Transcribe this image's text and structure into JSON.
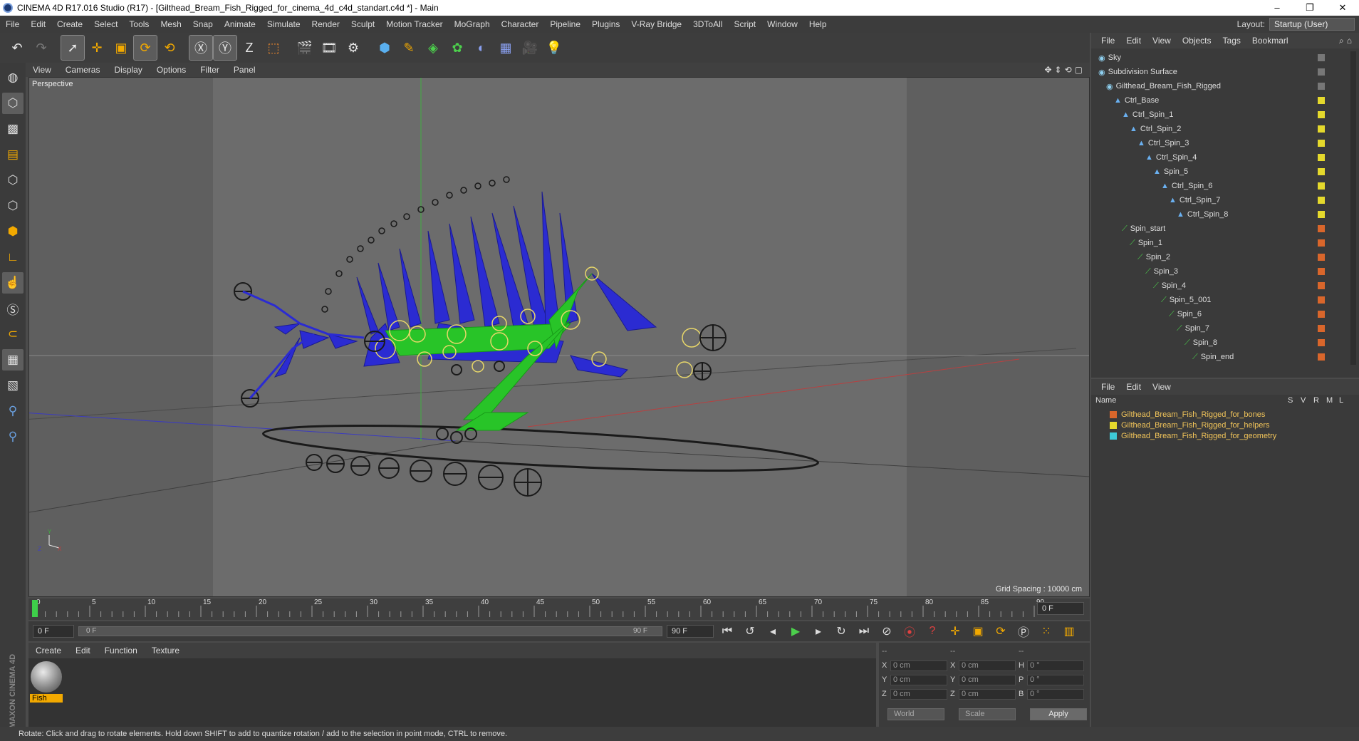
{
  "window": {
    "title": "CINEMA 4D R17.016 Studio (R17) - [Gilthead_Bream_Fish_Rigged_for_cinema_4d_c4d_standart.c4d *] - Main"
  },
  "menubar": {
    "items": [
      "File",
      "Edit",
      "Create",
      "Select",
      "Tools",
      "Mesh",
      "Snap",
      "Animate",
      "Simulate",
      "Render",
      "Sculpt",
      "Motion Tracker",
      "MoGraph",
      "Character",
      "Pipeline",
      "Plugins",
      "V-Ray Bridge",
      "3DToAll",
      "Script",
      "Window",
      "Help"
    ],
    "layout_label": "Layout:",
    "layout_value": "Startup (User)"
  },
  "viewport": {
    "menu": [
      "View",
      "Cameras",
      "Display",
      "Options",
      "Filter",
      "Panel"
    ],
    "label": "Perspective",
    "grid_spacing": "Grid Spacing : 10000 cm"
  },
  "timeline": {
    "ticks": [
      "0",
      "5",
      "10",
      "15",
      "20",
      "25",
      "30",
      "35",
      "40",
      "45",
      "50",
      "55",
      "60",
      "65",
      "70",
      "75",
      "80",
      "85",
      "90"
    ],
    "current_frame": "0 F",
    "start_frame": "0 F",
    "range_start": "0 F",
    "range_end": "90 F",
    "end_frame": "90 F"
  },
  "material": {
    "menu": [
      "Create",
      "Edit",
      "Function",
      "Texture"
    ],
    "name": "Fish"
  },
  "coords": {
    "header": [
      "--",
      "--",
      "--"
    ],
    "rows": [
      [
        {
          "l": "X",
          "v": "0 cm"
        },
        {
          "l": "X",
          "v": "0 cm"
        },
        {
          "l": "H",
          "v": "0 °"
        }
      ],
      [
        {
          "l": "Y",
          "v": "0 cm"
        },
        {
          "l": "Y",
          "v": "0 cm"
        },
        {
          "l": "P",
          "v": "0 °"
        }
      ],
      [
        {
          "l": "Z",
          "v": "0 cm"
        },
        {
          "l": "Z",
          "v": "0 cm"
        },
        {
          "l": "B",
          "v": "0 °"
        }
      ]
    ],
    "world": "World",
    "scale": "Scale",
    "apply": "Apply"
  },
  "objects": {
    "menu": [
      "File",
      "Edit",
      "View",
      "Objects",
      "Tags",
      "Bookmarl"
    ],
    "items": [
      {
        "name": "Sky",
        "depth": 0,
        "tag": "#777777"
      },
      {
        "name": "Subdivision Surface",
        "depth": 0,
        "tag": "#777777"
      },
      {
        "name": "Gilthead_Bream_Fish_Rigged",
        "depth": 1,
        "tag": "#777777"
      },
      {
        "name": "Ctrl_Base",
        "depth": 2,
        "tag": "#e5d92c"
      },
      {
        "name": "Ctrl_Spin_1",
        "depth": 3,
        "tag": "#e5d92c"
      },
      {
        "name": "Ctrl_Spin_2",
        "depth": 4,
        "tag": "#e5d92c"
      },
      {
        "name": "Ctrl_Spin_3",
        "depth": 5,
        "tag": "#e5d92c"
      },
      {
        "name": "Ctrl_Spin_4",
        "depth": 6,
        "tag": "#e5d92c"
      },
      {
        "name": "Spin_5",
        "depth": 7,
        "tag": "#e5d92c"
      },
      {
        "name": "Ctrl_Spin_6",
        "depth": 8,
        "tag": "#e5d92c"
      },
      {
        "name": "Ctrl_Spin_7",
        "depth": 9,
        "tag": "#e5d92c"
      },
      {
        "name": "Ctrl_Spin_8",
        "depth": 10,
        "tag": "#e5d92c"
      },
      {
        "name": "Spin_start",
        "depth": 3,
        "tag": "#d9662b"
      },
      {
        "name": "Spin_1",
        "depth": 4,
        "tag": "#d9662b"
      },
      {
        "name": "Spin_2",
        "depth": 5,
        "tag": "#d9662b"
      },
      {
        "name": "Spin_3",
        "depth": 6,
        "tag": "#d9662b"
      },
      {
        "name": "Spin_4",
        "depth": 7,
        "tag": "#d9662b"
      },
      {
        "name": "Spin_5_001",
        "depth": 8,
        "tag": "#d9662b"
      },
      {
        "name": "Spin_6",
        "depth": 9,
        "tag": "#d9662b"
      },
      {
        "name": "Spin_7",
        "depth": 10,
        "tag": "#d9662b"
      },
      {
        "name": "Spin_8",
        "depth": 11,
        "tag": "#d9662b"
      },
      {
        "name": "Spin_end",
        "depth": 12,
        "tag": "#d9662b"
      }
    ]
  },
  "layers": {
    "menu": [
      "File",
      "Edit",
      "View"
    ],
    "columns": [
      "Name",
      "S",
      "V",
      "R",
      "M",
      "L"
    ],
    "items": [
      {
        "name": "Gilthead_Bream_Fish_Rigged_for_bones",
        "color": "#d9662b"
      },
      {
        "name": "Gilthead_Bream_Fish_Rigged_for_helpers",
        "color": "#e5d92c"
      },
      {
        "name": "Gilthead_Bream_Fish_Rigged_for_geometry",
        "color": "#3ec9d6"
      }
    ]
  },
  "status": {
    "text": "Rotate: Click and drag to rotate elements. Hold down SHIFT to add to quantize rotation / add to the selection in point mode, CTRL to remove."
  }
}
